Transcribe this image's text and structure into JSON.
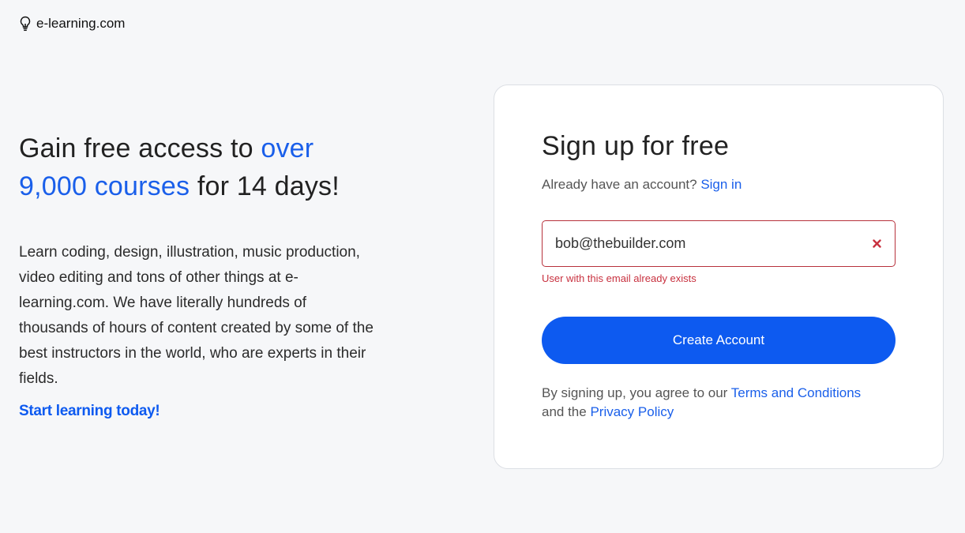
{
  "brand": {
    "name": "e-learning.com",
    "icon": "lightbulb-icon"
  },
  "hero": {
    "headline_part1": "Gain free access to ",
    "headline_accent": "over 9,000 courses",
    "headline_part2": " for 14 days!",
    "body": "Learn coding, design, illustration, music production, video editing and tons of other things at e-learning.com. We have literally hundreds of thousands of hours of content created by some of the best instructors in the world, who are experts in their fields.",
    "cta_label": "Start learning today!"
  },
  "signup": {
    "title": "Sign up for free",
    "account_prompt": "Already have an account? ",
    "signin_label": "Sign in",
    "email_value": "bob@thebuilder.com",
    "email_error": "User with this email already exists",
    "submit_label": "Create Account",
    "terms_prefix": "By signing up, you agree to our ",
    "terms_link": "Terms and Conditions",
    "terms_mid": " and the ",
    "privacy_link": "Privacy Policy"
  },
  "colors": {
    "accent": "#0d5af0",
    "error": "#c8313f",
    "background": "#f6f7f9"
  }
}
